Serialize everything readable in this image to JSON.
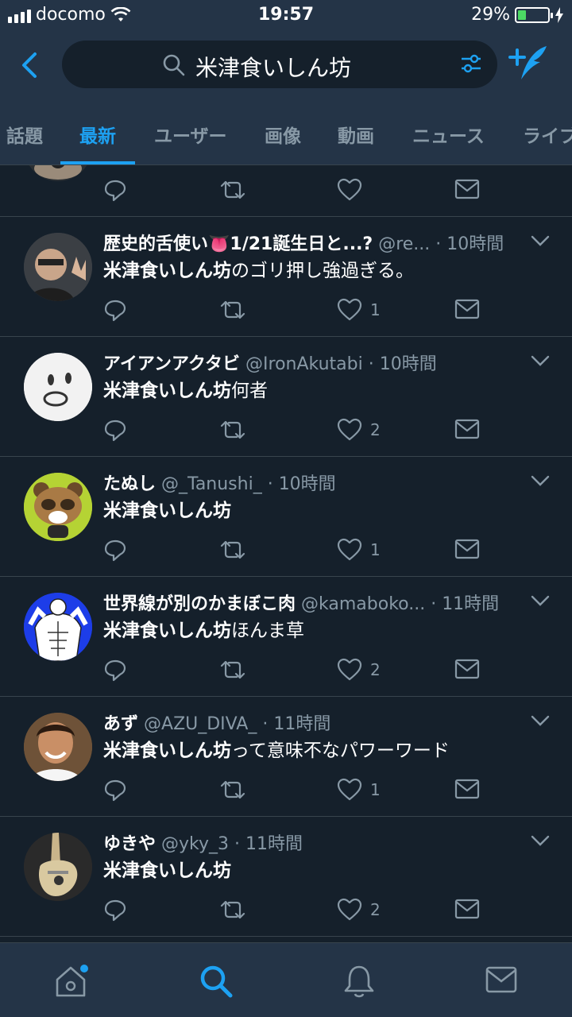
{
  "status": {
    "carrier": "docomo",
    "time": "19:57",
    "battery": "29%"
  },
  "search": {
    "query": "米津食いしん坊"
  },
  "tabs": [
    "話題",
    "最新",
    "ユーザー",
    "画像",
    "動画",
    "ニュース",
    "ライブ"
  ],
  "active_tab": "最新",
  "tweets": [
    {
      "name": "歴史的舌使い👅1/21誕生日と...?",
      "handle": "@re...",
      "time": "· 10時間",
      "keyword": "米津食いしん坊",
      "rest": "のゴリ押し強過ぎる。",
      "likes": "1"
    },
    {
      "name": "アイアンアクタビ",
      "handle": "@IronAkutabi",
      "time": "· 10時間",
      "keyword": "米津食いしん坊",
      "rest": "何者",
      "likes": "2"
    },
    {
      "name": "たぬし",
      "handle": "@_Tanushi_",
      "time": "· 10時間",
      "keyword": "米津食いしん坊",
      "rest": "",
      "likes": "1"
    },
    {
      "name": "世界線が別のかまぼこ肉",
      "handle": "@kamaboko...",
      "time": "· 11時間",
      "keyword": "米津食いしん坊",
      "rest": "ほんま草",
      "likes": "2"
    },
    {
      "name": "あず",
      "handle": "@AZU_DIVA_",
      "time": "· 11時間",
      "keyword": "米津食いしん坊",
      "rest": "って意味不なパワーワード",
      "likes": "1"
    },
    {
      "name": "ゆきや",
      "handle": "@yky_3",
      "time": "· 11時間",
      "keyword": "米津食いしん坊",
      "rest": "",
      "likes": "2"
    }
  ],
  "icons": {
    "back": "chevron-left-icon",
    "search": "search-icon",
    "filter": "filter-icon",
    "compose": "compose-icon",
    "reply": "reply-icon",
    "retweet": "retweet-icon",
    "like": "heart-icon",
    "dm": "envelope-icon",
    "caret": "chevron-down-icon",
    "nav": [
      "home-icon",
      "search-icon",
      "bell-icon",
      "envelope-icon"
    ]
  },
  "colors": {
    "accent": "#1da1f2",
    "background": "#15202b",
    "header": "#243447",
    "muted": "#8899a6",
    "battery": "#4cd964"
  }
}
